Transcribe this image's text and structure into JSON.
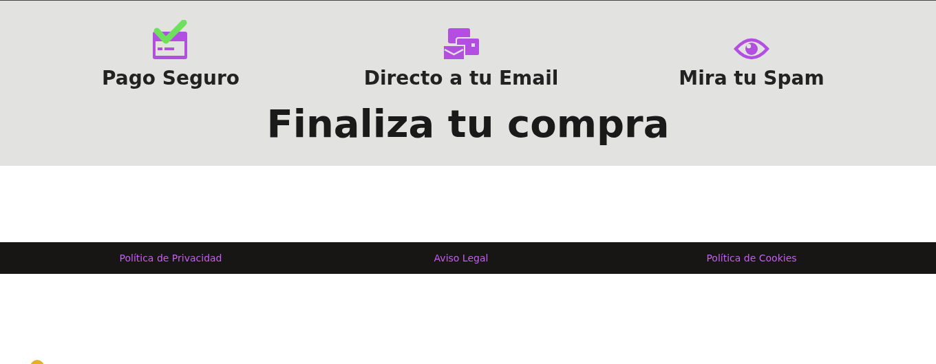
{
  "features": [
    {
      "title": "Pago Seguro"
    },
    {
      "title": "Directo a tu Email"
    },
    {
      "title": "Mira tu Spam"
    }
  ],
  "heading": "Finaliza tu compra",
  "footer_links": [
    "Política de Privacidad",
    "Aviso Legal",
    "Política de Cookies"
  ]
}
